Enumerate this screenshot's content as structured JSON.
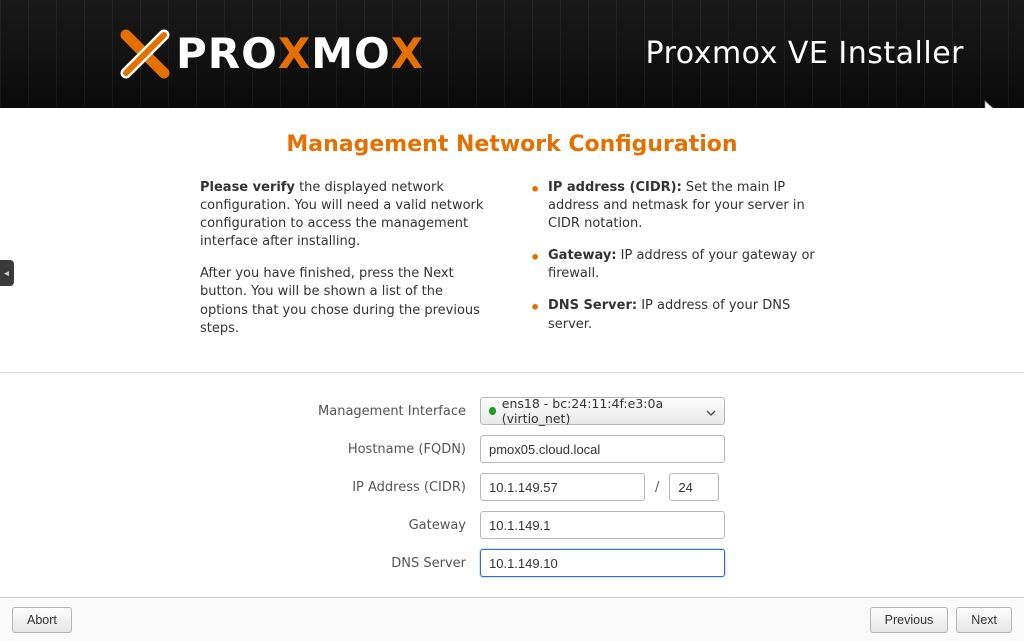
{
  "colors": {
    "accent": "#e57000",
    "focus": "#2a6ed6",
    "link_status": "#19a019"
  },
  "banner": {
    "brand": {
      "p": "PRO",
      "x1": "X",
      "mo": "MO",
      "x2": "X"
    },
    "title": "Proxmox VE Installer"
  },
  "page": {
    "title": "Management Network Configuration",
    "left": {
      "p1_bold": "Please verify",
      "p1_rest": " the displayed network configuration. You will need a valid network configuration to access the management interface after installing.",
      "p2": "After you have finished, press the Next button. You will be shown a list of the options that you chose during the previous steps."
    },
    "right": {
      "items": [
        {
          "label": "IP address (CIDR):",
          "text": " Set the main IP address and netmask for your server in CIDR notation."
        },
        {
          "label": "Gateway:",
          "text": " IP address of your gateway or firewall."
        },
        {
          "label": "DNS Server:",
          "text": " IP address of your DNS server."
        }
      ]
    }
  },
  "form": {
    "mgmt_iface": {
      "label": "Management Interface",
      "value": "ens18 - bc:24:11:4f:e3:0a (virtio_net)"
    },
    "hostname": {
      "label": "Hostname (FQDN)",
      "value": "pmox05.cloud.local"
    },
    "ip": {
      "label": "IP Address (CIDR)",
      "value": "10.1.149.57",
      "mask": "24",
      "separator": "/"
    },
    "gateway": {
      "label": "Gateway",
      "value": "10.1.149.1"
    },
    "dns": {
      "label": "DNS Server",
      "value": "10.1.149.10"
    }
  },
  "footer": {
    "abort": "Abort",
    "previous": "Previous",
    "next": "Next"
  }
}
